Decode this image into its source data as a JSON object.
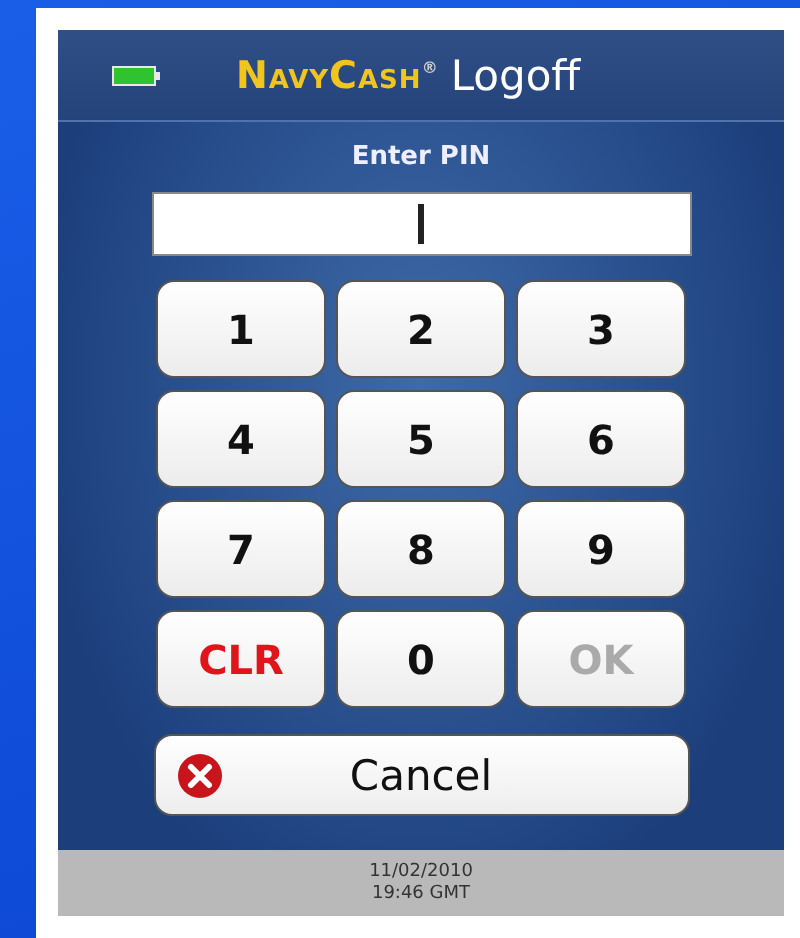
{
  "header": {
    "brand": "NavyCash$^{®}$",
    "logoff": "Logoff"
  },
  "prompt": "Enter PIN",
  "keys": [
    {
      "label": "1",
      "kind": "digit",
      "disabled": false
    },
    {
      "label": "2",
      "kind": "digit",
      "disabled": false
    },
    {
      "label": "3",
      "kind": "digit",
      "disabled": false
    },
    {
      "label": "4",
      "kind": "digit",
      "disabled": false
    },
    {
      "label": "5",
      "kind": "digit",
      "disabled": false
    },
    {
      "label": "6",
      "kind": "digit",
      "disabled": false
    },
    {
      "label": "7",
      "kind": "digit",
      "disabled": false
    },
    {
      "label": "8",
      "kind": "digit",
      "disabled": false
    },
    {
      "label": "9",
      "kind": "digit",
      "disabled": false
    },
    {
      "label": "CLR",
      "kind": "clear",
      "disabled": false
    },
    {
      "label": "0",
      "kind": "digit",
      "disabled": false
    },
    {
      "label": "OK",
      "kind": "ok",
      "disabled": true
    }
  ],
  "cancel": "Cancel",
  "footer": {
    "date": "11/02/2010",
    "time": "19:46 GMT"
  }
}
